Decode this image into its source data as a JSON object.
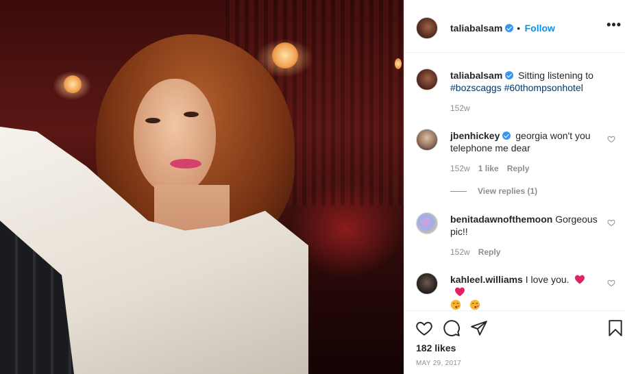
{
  "post": {
    "author": "taliabalsam",
    "follow_label": "Follow",
    "separator": "•",
    "more_label": "•••",
    "caption_text": "Sitting listening to",
    "caption_hashtags": [
      "#bozscaggs",
      "#60thompsonhotel"
    ],
    "caption_time": "152w",
    "likes": "182 likes",
    "date": "May 29, 2017"
  },
  "comments": [
    {
      "username": "jbenhickey",
      "verified": true,
      "text": "georgia won't you telephone me dear",
      "time": "152w",
      "likes": "1 like",
      "reply_label": "Reply",
      "view_replies": "View replies (1)"
    },
    {
      "username": "benitadawnofthemoon",
      "verified": false,
      "text": "Gorgeous pic!!",
      "time": "152w",
      "reply_label": "Reply"
    },
    {
      "username": "kahleel.williams",
      "verified": false,
      "text": "I love you."
    }
  ],
  "icons": {
    "like": "heart-icon",
    "comment": "comment-icon",
    "share": "share-icon",
    "save": "bookmark-icon"
  },
  "colors": {
    "link": "#0095f6",
    "verified": "#3897f0",
    "hashtag": "#00376b",
    "muted": "#8e8e8e",
    "heart_emoji": "#e0245e"
  }
}
